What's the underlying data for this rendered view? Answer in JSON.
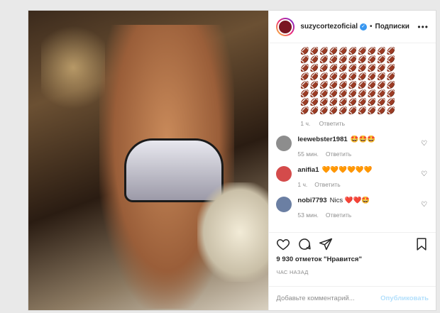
{
  "post": {
    "username": "suzycortezoficial",
    "follow_separator": "•",
    "follow_label": "Подписки",
    "more_label": "•••",
    "emoji_block": [
      "🏈🏈🏈🏈🏈🏈🏈🏈🏈🏈",
      "🏈🏈🏈🏈🏈🏈🏈🏈🏈🏈",
      "🏈🏈🏈🏈🏈🏈🏈🏈🏈🏈",
      "🏈🏈🏈🏈🏈🏈🏈🏈🏈🏈",
      "🏈🏈🏈🏈🏈🏈🏈🏈🏈🏈",
      "🏈🏈🏈🏈🏈🏈🏈🏈🏈🏈",
      "🏈🏈🏈🏈🏈🏈🏈🏈🏈🏈",
      "🏈🏈🏈🏈🏈🏈🏈🏈🏈🏈"
    ],
    "emoji_meta": {
      "time": "1 ч.",
      "reply": "Ответить"
    }
  },
  "comments": [
    {
      "user": "leewebster1981",
      "text": "🤩🤩🤩",
      "time": "55 мин.",
      "reply": "Ответить",
      "avatar_color": "#8d8d8d"
    },
    {
      "user": "anifia1",
      "text": "🧡🧡🧡🧡🧡🧡",
      "time": "1 ч.",
      "reply": "Ответить",
      "avatar_color": "#d44b4b"
    },
    {
      "user": "nobi7793",
      "text": "Nics ❤️❤️🤩",
      "time": "53 мин.",
      "reply": "Ответить",
      "avatar_color": "#6b7fa3"
    }
  ],
  "actions": {
    "likes_count": "9 930",
    "likes_text": "отметок \"Нравится\"",
    "posted_time": "ЧАС НАЗАД"
  },
  "add_comment": {
    "placeholder": "Добавьте комментарий...",
    "publish_label": "Опубликовать"
  },
  "colors": {
    "accent": "#3897f0",
    "publish_disabled": "#b2dffc"
  }
}
